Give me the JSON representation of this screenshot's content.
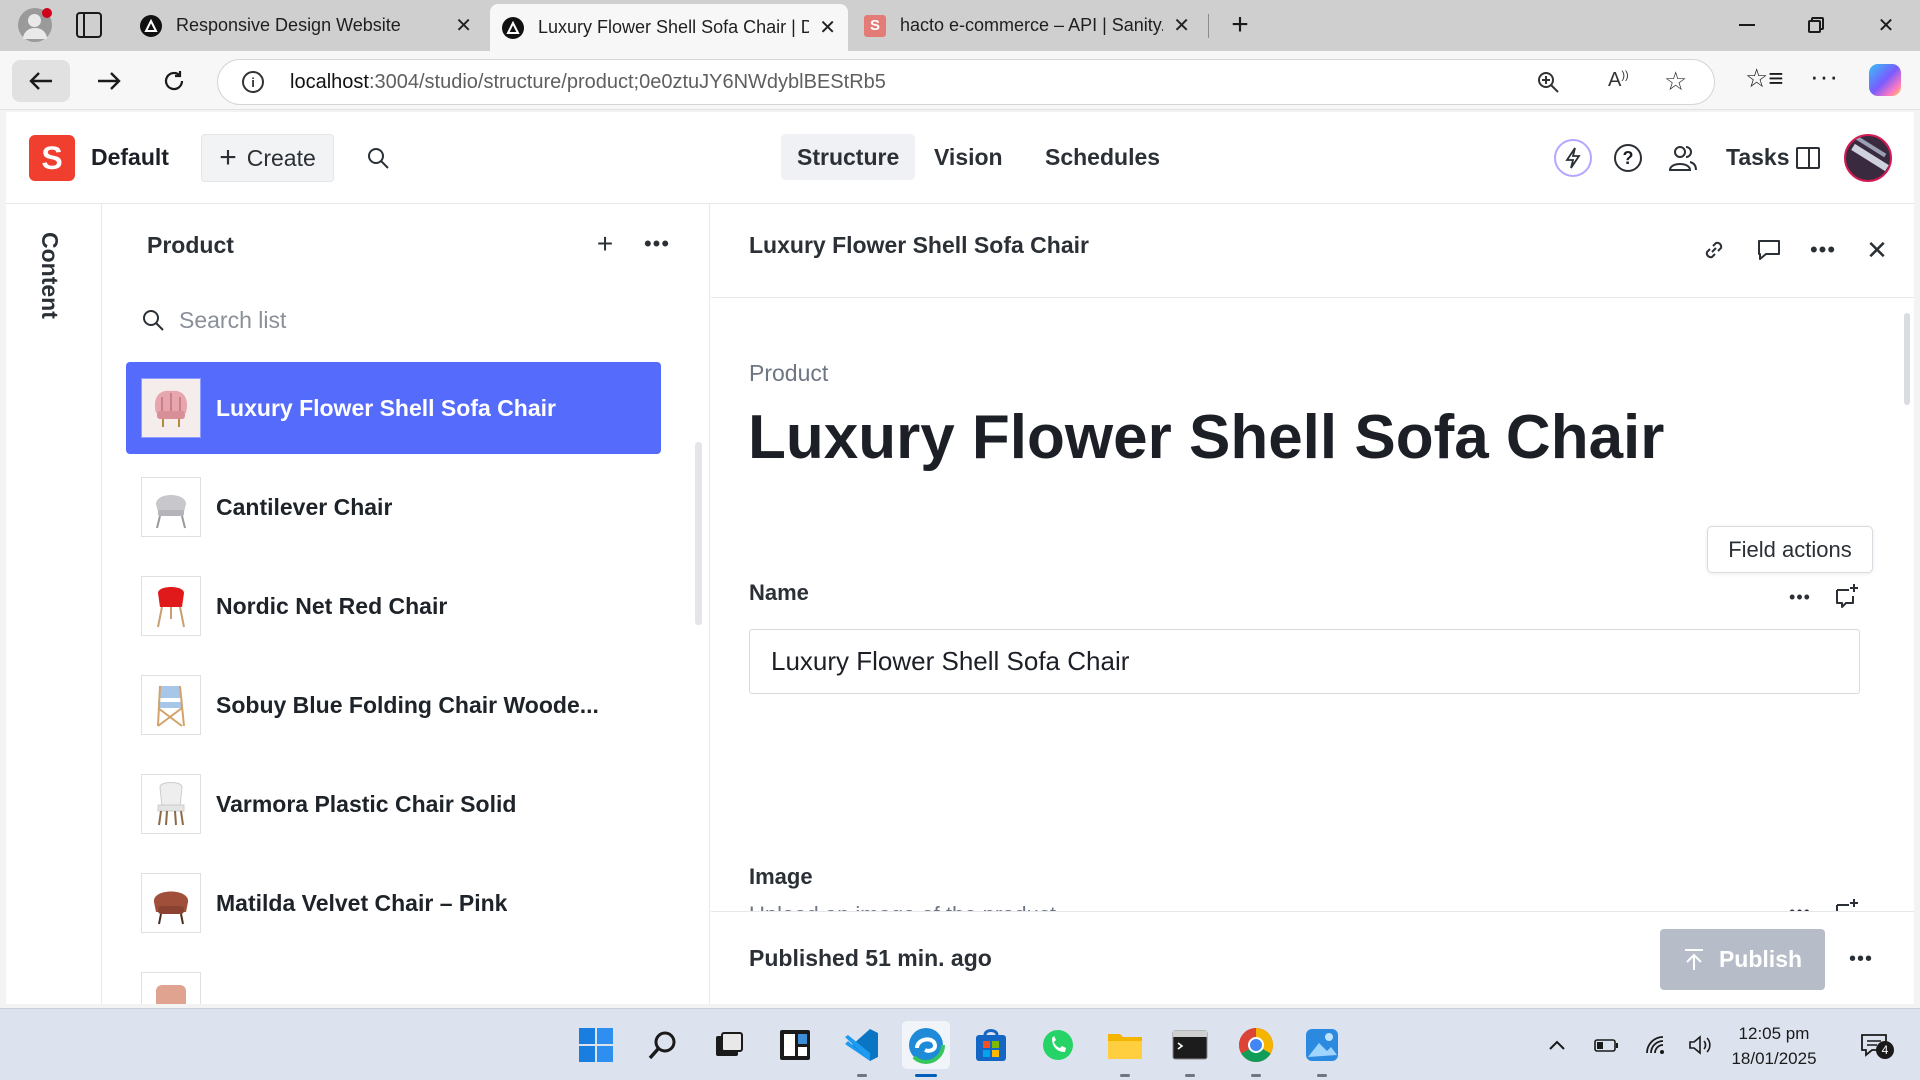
{
  "browser": {
    "tabs": [
      {
        "title": "Responsive Design Website",
        "active": false
      },
      {
        "title": "Luxury Flower Shell Sofa Chair | D",
        "active": true
      },
      {
        "title": "hacto e-commerce – API | Sanity.i",
        "active": false
      }
    ],
    "url_host": "localhost",
    "url_path": ":3004/studio/structure/product;0e0ztuJY6NWdyblBEStRb5",
    "new_tab_label": "+"
  },
  "studio": {
    "logo_letter": "S",
    "workspace": "Default",
    "create_label": "Create",
    "nav": [
      "Structure",
      "Vision",
      "Schedules"
    ],
    "tasks_label": "Tasks",
    "rail_label": "Content"
  },
  "list": {
    "title": "Product",
    "search_placeholder": "Search list",
    "items": [
      {
        "title": "Luxury Flower Shell Sofa Chair",
        "selected": true,
        "thumb": "pink-shell-chair"
      },
      {
        "title": "Cantilever Chair",
        "selected": false,
        "thumb": "grey-cantilever-chair"
      },
      {
        "title": "Nordic Net Red Chair",
        "selected": false,
        "thumb": "red-chair"
      },
      {
        "title": "Sobuy Blue Folding Chair Woode...",
        "selected": false,
        "thumb": "wooden-folding-chair"
      },
      {
        "title": "Varmora Plastic Chair Solid",
        "selected": false,
        "thumb": "white-plastic-chair"
      },
      {
        "title": "Matilda Velvet Chair – Pink",
        "selected": false,
        "thumb": "velvet-chair"
      },
      {
        "title": "",
        "selected": false,
        "thumb": "tufted-chair"
      }
    ]
  },
  "document": {
    "header_title": "Luxury Flower Shell Sofa Chair",
    "type_label": "Product",
    "title": "Luxury Flower Shell Sofa Chair",
    "tooltip": "Field actions",
    "fields": {
      "name": {
        "label": "Name",
        "value": "Luxury Flower Shell Sofa Chair"
      },
      "image": {
        "label": "Image",
        "description": "Upload an image of the product."
      }
    },
    "status": "Published 51 min. ago",
    "publish_label": "Publish"
  },
  "taskbar": {
    "time": "12:05 pm",
    "date": "18/01/2025",
    "notification_count": "4"
  },
  "colors": {
    "accent": "#556bfc",
    "sanity_red": "#f03e2f",
    "publish_disabled": "#b6bdc8"
  }
}
